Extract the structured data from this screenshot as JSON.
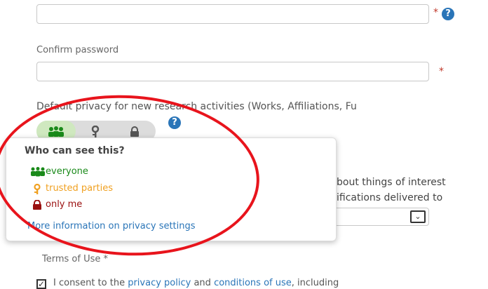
{
  "form": {
    "password_required": "*",
    "password_help_icon": "?",
    "confirm_label": "Confirm password",
    "confirm_required": "*",
    "privacy_label": "Default privacy for new research activities (Works, Affiliations, Fu",
    "privacy_help_icon": "?",
    "notifications_line1": "bout things of interest",
    "notifications_line2": "ifications delivered to",
    "select_arrow": "⌄",
    "terms_label": "Terms of Use *",
    "consent_prefix": "I consent to the ",
    "consent_privacy_link": "privacy policy",
    "consent_and": " and ",
    "consent_conditions_link": "conditions of use",
    "consent_suffix": ", including"
  },
  "privacy_popup": {
    "title": "Who can see this?",
    "options": [
      {
        "label": "everyone",
        "color": "#1a8a1a",
        "icon": "group-icon"
      },
      {
        "label": "trusted parties",
        "color": "#f0a020",
        "icon": "key-icon"
      },
      {
        "label": "only me",
        "color": "#9a1010",
        "icon": "lock-icon"
      }
    ],
    "more_info_link": "More information on privacy settings"
  },
  "colors": {
    "annotation_circle": "#e8141c",
    "help": "#2a75b8",
    "required": "#c0392b"
  }
}
